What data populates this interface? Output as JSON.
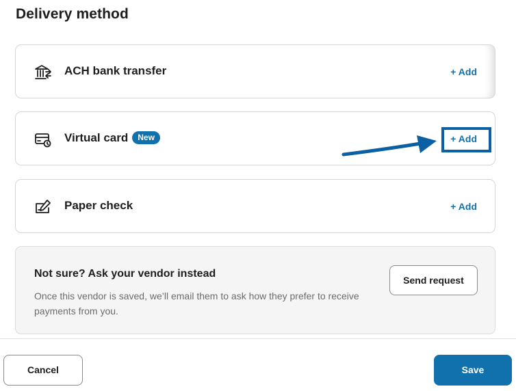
{
  "page": {
    "title": "Delivery method"
  },
  "methods": [
    {
      "icon": "bank-icon",
      "label": "ACH bank transfer",
      "action": "+ Add"
    },
    {
      "icon": "virtual-card-icon",
      "label": "Virtual card",
      "badge": "New",
      "action": "+ Add"
    },
    {
      "icon": "paper-check-icon",
      "label": "Paper check",
      "action": "+ Add"
    }
  ],
  "info": {
    "title": "Not sure? Ask your vendor instead",
    "text": "Once this vendor is saved, we’ll email them to ask how they prefer to receive payments from you.",
    "button": "Send request"
  },
  "footer": {
    "cancel": "Cancel",
    "save": "Save"
  },
  "colors": {
    "accent": "#1171ad",
    "annotation": "#0b5fa3"
  }
}
